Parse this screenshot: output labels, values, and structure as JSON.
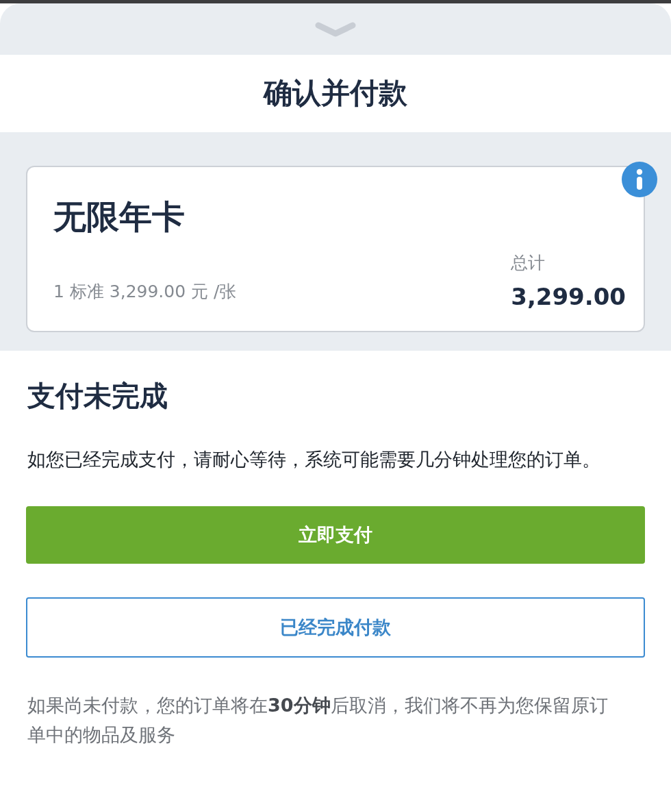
{
  "sheet": {
    "title": "确认并付款"
  },
  "product_card": {
    "name": "无限年卡",
    "detail": "1 标准 3,299.00 元 /张",
    "total_label": "总计",
    "total": "3,299.00"
  },
  "payment_status": {
    "heading": "支付未完成",
    "message": "如您已经完成支付，请耐心等待，系统可能需要几分钟处理您的订单。",
    "buttons": [
      {
        "label": "立即支付",
        "kind": "primary"
      },
      {
        "label": "已经完成付款",
        "kind": "secondary"
      }
    ],
    "notice": "如果尚未付款，您的订单将在**30分钟**后取消，我们将不再为您保留原订单中的物品及服务"
  }
}
